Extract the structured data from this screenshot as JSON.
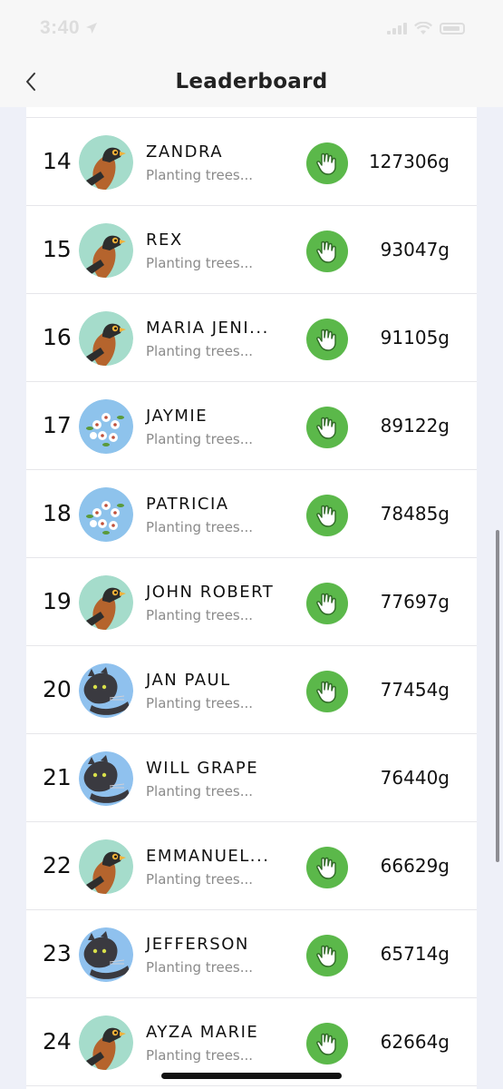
{
  "status_bar": {
    "time": "3:40"
  },
  "nav": {
    "title": "Leaderboard"
  },
  "colors": {
    "badge_green": "#5bb84a",
    "background": "#eef0f8"
  },
  "leaderboard": [
    {
      "rank": "14",
      "name": "ZANDRA",
      "subtitle": "Planting trees...",
      "score": "127306g",
      "avatar": "bird-avatar-icon",
      "badge": true
    },
    {
      "rank": "15",
      "name": "REX",
      "subtitle": "Planting trees...",
      "score": "93047g",
      "avatar": "bird-avatar-icon",
      "badge": true
    },
    {
      "rank": "16",
      "name": "MARIA JENI...",
      "subtitle": "Planting trees...",
      "score": "91105g",
      "avatar": "bird-avatar-icon",
      "badge": true
    },
    {
      "rank": "17",
      "name": "JAYMIE",
      "subtitle": "Planting trees...",
      "score": "89122g",
      "avatar": "flower-avatar-icon",
      "badge": true
    },
    {
      "rank": "18",
      "name": "PATRICIA",
      "subtitle": "Planting trees...",
      "score": "78485g",
      "avatar": "flower-avatar-icon",
      "badge": true
    },
    {
      "rank": "19",
      "name": "JOHN ROBERT",
      "subtitle": "Planting trees...",
      "score": "77697g",
      "avatar": "bird-avatar-icon",
      "badge": true
    },
    {
      "rank": "20",
      "name": "JAN PAUL",
      "subtitle": "Planting trees...",
      "score": "77454g",
      "avatar": "panther-avatar-icon",
      "badge": true
    },
    {
      "rank": "21",
      "name": "WILL GRAPE",
      "subtitle": "Planting trees...",
      "score": "76440g",
      "avatar": "panther-avatar-icon",
      "badge": false
    },
    {
      "rank": "22",
      "name": "EMMANUEL...",
      "subtitle": "Planting trees...",
      "score": "66629g",
      "avatar": "bird-avatar-icon",
      "badge": true
    },
    {
      "rank": "23",
      "name": "JEFFERSON",
      "subtitle": "Planting trees...",
      "score": "65714g",
      "avatar": "panther-avatar-icon",
      "badge": true
    },
    {
      "rank": "24",
      "name": "AYZA MARIE",
      "subtitle": "Planting trees...",
      "score": "62664g",
      "avatar": "bird-avatar-icon",
      "badge": true
    }
  ]
}
